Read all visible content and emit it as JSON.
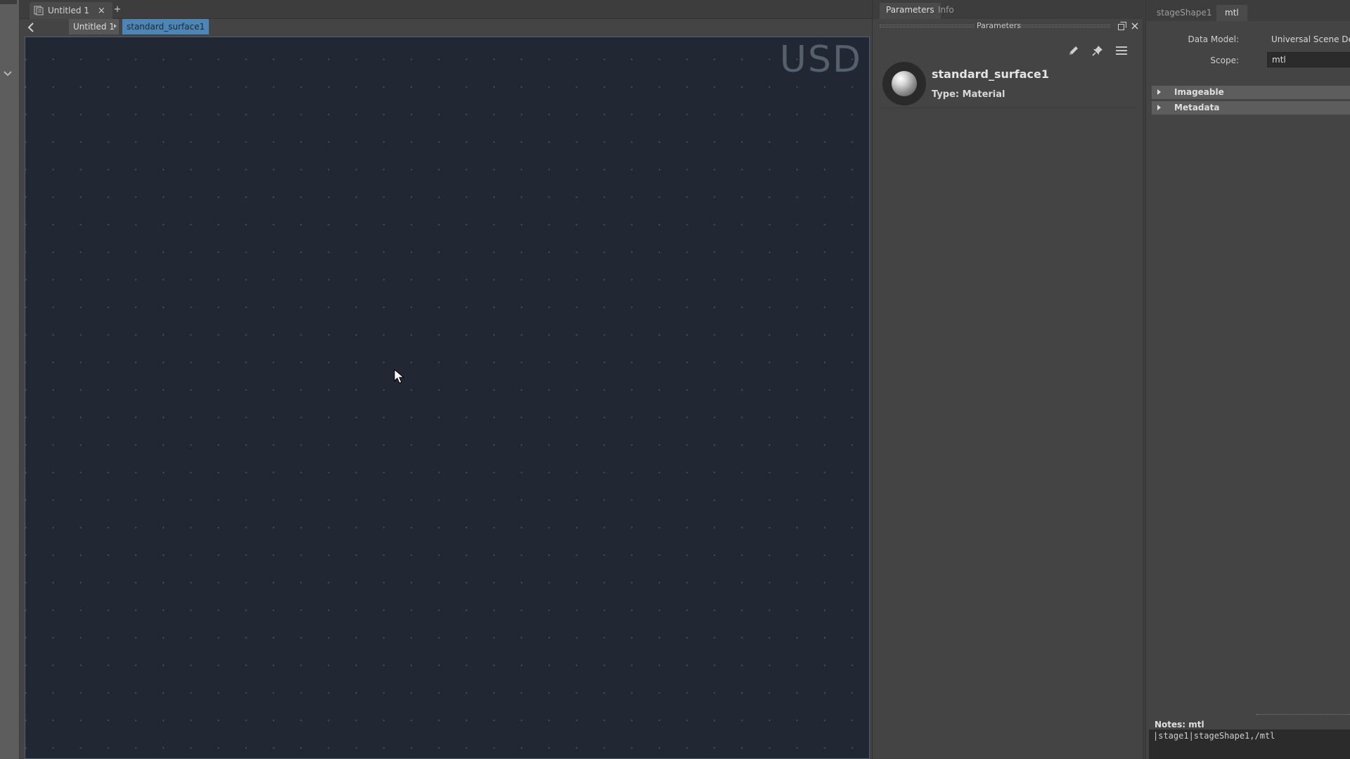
{
  "document_tabs": [
    {
      "label": "Untitled 1",
      "close": "×"
    }
  ],
  "add_tab_label": "+",
  "breadcrumb": {
    "items": [
      "Untitled 1",
      "standard_surface1"
    ]
  },
  "graph": {
    "watermark": "USD"
  },
  "parameters_panel": {
    "tabs": [
      "Parameters",
      "Info"
    ],
    "title": "Parameters",
    "node_name": "standard_surface1",
    "node_type": "Type: Material"
  },
  "attribute_editor": {
    "tabs": [
      "stageShape1",
      "mtl"
    ],
    "data_model_label": "Data Model:",
    "data_model_value": "Universal Scene Descr",
    "scope_label": "Scope:",
    "scope_value": "mtl",
    "frames": [
      "Imageable",
      "Metadata"
    ],
    "notes_label": "Notes: mtl",
    "notes_text": "|stage1|stageShape1,/mtl"
  },
  "colors": {
    "canvas_bg": "#212833",
    "breadcrumb_active": "#4d86b4",
    "panel_bg": "#444444"
  },
  "icons": [
    "chevron-down-icon",
    "document-icon",
    "close-icon",
    "back-arrow-icon",
    "cursor-icon",
    "float-panel-icon",
    "pencil-icon",
    "pin-icon",
    "menu-icon",
    "material-sphere-icon",
    "expand-triangle-icon"
  ]
}
